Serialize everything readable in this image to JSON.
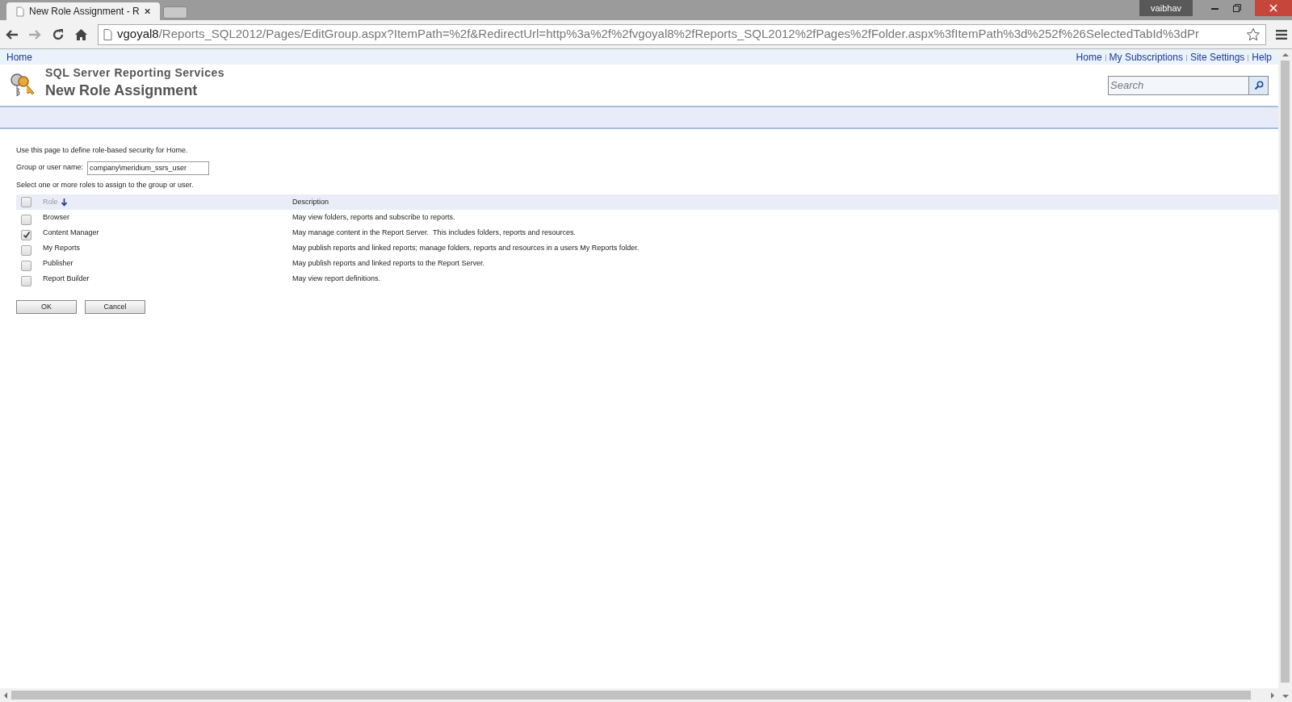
{
  "browser": {
    "tab_title": "New Role Assignment - R",
    "user": "vaibhav",
    "address_host": "vgoyal8",
    "address_path": "/Reports_SQL2012/Pages/EditGroup.aspx?ItemPath=%2f&RedirectUrl=http%3a%2f%2fvgoyal8%2fReports_SQL2012%2fPages%2fFolder.aspx%3fItemPath%3d%252f%26SelectedTabId%3dPr"
  },
  "breadcrumb": "Home",
  "top_links": [
    "Home",
    "My Subscriptions",
    "Site Settings",
    "Help"
  ],
  "header": {
    "product": "SQL Server Reporting Services",
    "title": "New Role Assignment"
  },
  "search": {
    "placeholder": "Search"
  },
  "intro": "Use this page to define role-based security for Home.",
  "user_field": {
    "label": "Group or user name:",
    "value": "company\\meridium_ssrs_user"
  },
  "instruction": "Select one or more roles to assign to the group or user.",
  "table": {
    "select_all_checked": false,
    "columns": [
      "Role",
      "Description"
    ],
    "rows": [
      {
        "role": "Browser",
        "description": "May view folders, reports and subscribe to reports.",
        "checked": false
      },
      {
        "role": "Content Manager",
        "description": "May manage content in the Report Server.  This includes folders, reports and resources.",
        "checked": true
      },
      {
        "role": "My Reports",
        "description": "May publish reports and linked reports; manage folders, reports and resources in a users My Reports folder.",
        "checked": false
      },
      {
        "role": "Publisher",
        "description": "May publish reports and linked reports to the Report Server.",
        "checked": false
      },
      {
        "role": "Report Builder",
        "description": "May view report definitions.",
        "checked": false
      }
    ]
  },
  "buttons": [
    "OK",
    "Cancel"
  ]
}
